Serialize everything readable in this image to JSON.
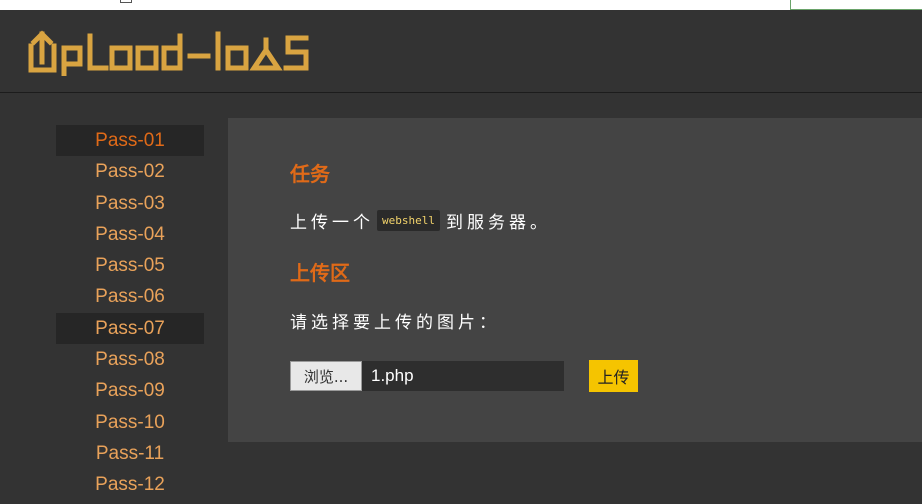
{
  "header": {
    "logo_text": "UpLoad-labS"
  },
  "sidebar": {
    "items": [
      {
        "label": "Pass-01"
      },
      {
        "label": "Pass-02"
      },
      {
        "label": "Pass-03"
      },
      {
        "label": "Pass-04"
      },
      {
        "label": "Pass-05"
      },
      {
        "label": "Pass-06"
      },
      {
        "label": "Pass-07"
      },
      {
        "label": "Pass-08"
      },
      {
        "label": "Pass-09"
      },
      {
        "label": "Pass-10"
      },
      {
        "label": "Pass-11"
      },
      {
        "label": "Pass-12"
      }
    ],
    "active_index": 0,
    "highlight_index": 6
  },
  "task": {
    "heading": "任务",
    "text_before": "上传一个",
    "code": "webshell",
    "text_after": "到服务器。"
  },
  "upload": {
    "heading": "上传区",
    "prompt": "请选择要上传的图片：",
    "browse_label": "浏览...",
    "file_value": "1.php",
    "submit_label": "上传"
  },
  "colors": {
    "accent": "#e06a18",
    "nav_text": "#e9a25a",
    "logo": "#d9a441",
    "submit": "#f5c400"
  }
}
